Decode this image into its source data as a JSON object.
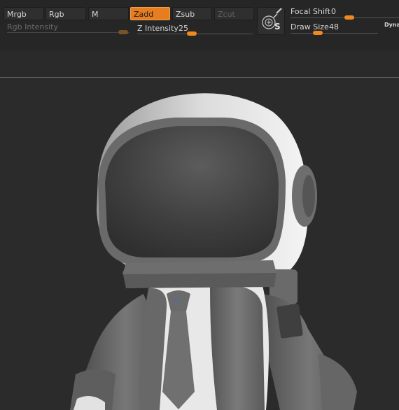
{
  "toolbar": {
    "modes": [
      "Mrgb",
      "Rgb",
      "M",
      "Zadd",
      "Zsub",
      "Zcut"
    ],
    "active_mode": "Zadd",
    "rgb_intensity": {
      "label": "Rgb Intensity"
    },
    "z_intensity": {
      "label": "Z Intensity",
      "value": "25"
    },
    "focal_shift": {
      "label": "Focal Shift",
      "value": "0"
    },
    "draw_size": {
      "label": "Draw Size",
      "value": "48"
    },
    "draw_icon_letter": "S",
    "dyna_label": "Dyna"
  },
  "colors": {
    "accent": "#e67d1e",
    "background": "#2c2c2c",
    "model_gray": "#6e6e6e",
    "model_white": "#e8e8e8"
  },
  "icons": {
    "draw_icon": "draw-size-icon",
    "viewport_model": "astronaut-3d-model"
  }
}
